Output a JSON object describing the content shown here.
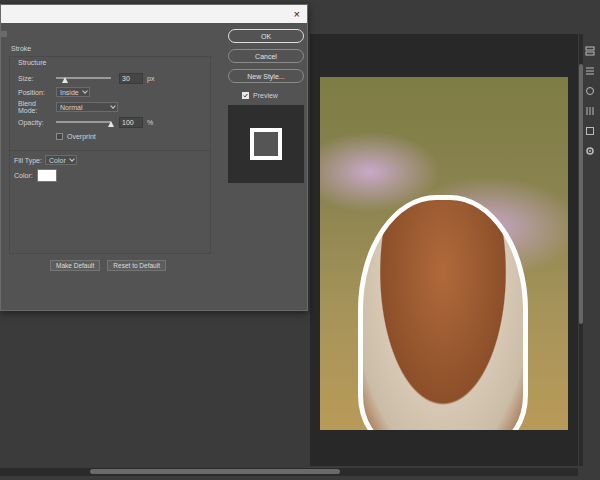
{
  "dialog": {
    "close": "×"
  },
  "section": {
    "title": "Stroke",
    "group": "Structure"
  },
  "size": {
    "label": "Size:",
    "level": 0.16,
    "value": "30",
    "unit": "px"
  },
  "position": {
    "label": "Position:",
    "value": "Inside"
  },
  "blend_mode": {
    "label": "Blend Mode:",
    "value": "Normal"
  },
  "opacity": {
    "label": "Opacity:",
    "level": 1.0,
    "value": "100",
    "unit": "%"
  },
  "overprint": {
    "label": "Overprint",
    "checked": false
  },
  "fill_type": {
    "label": "Fill Type:",
    "value": "Color"
  },
  "color": {
    "label": "Color:",
    "color": "#ffffff"
  },
  "defaults_buttons": [
    "Make Default",
    "Reset to Default"
  ],
  "buttons": [
    {
      "label": "OK"
    },
    {
      "label": "Cancel"
    },
    {
      "label": "New Style..."
    }
  ],
  "preview": {
    "label": "Preview",
    "checked": true
  }
}
